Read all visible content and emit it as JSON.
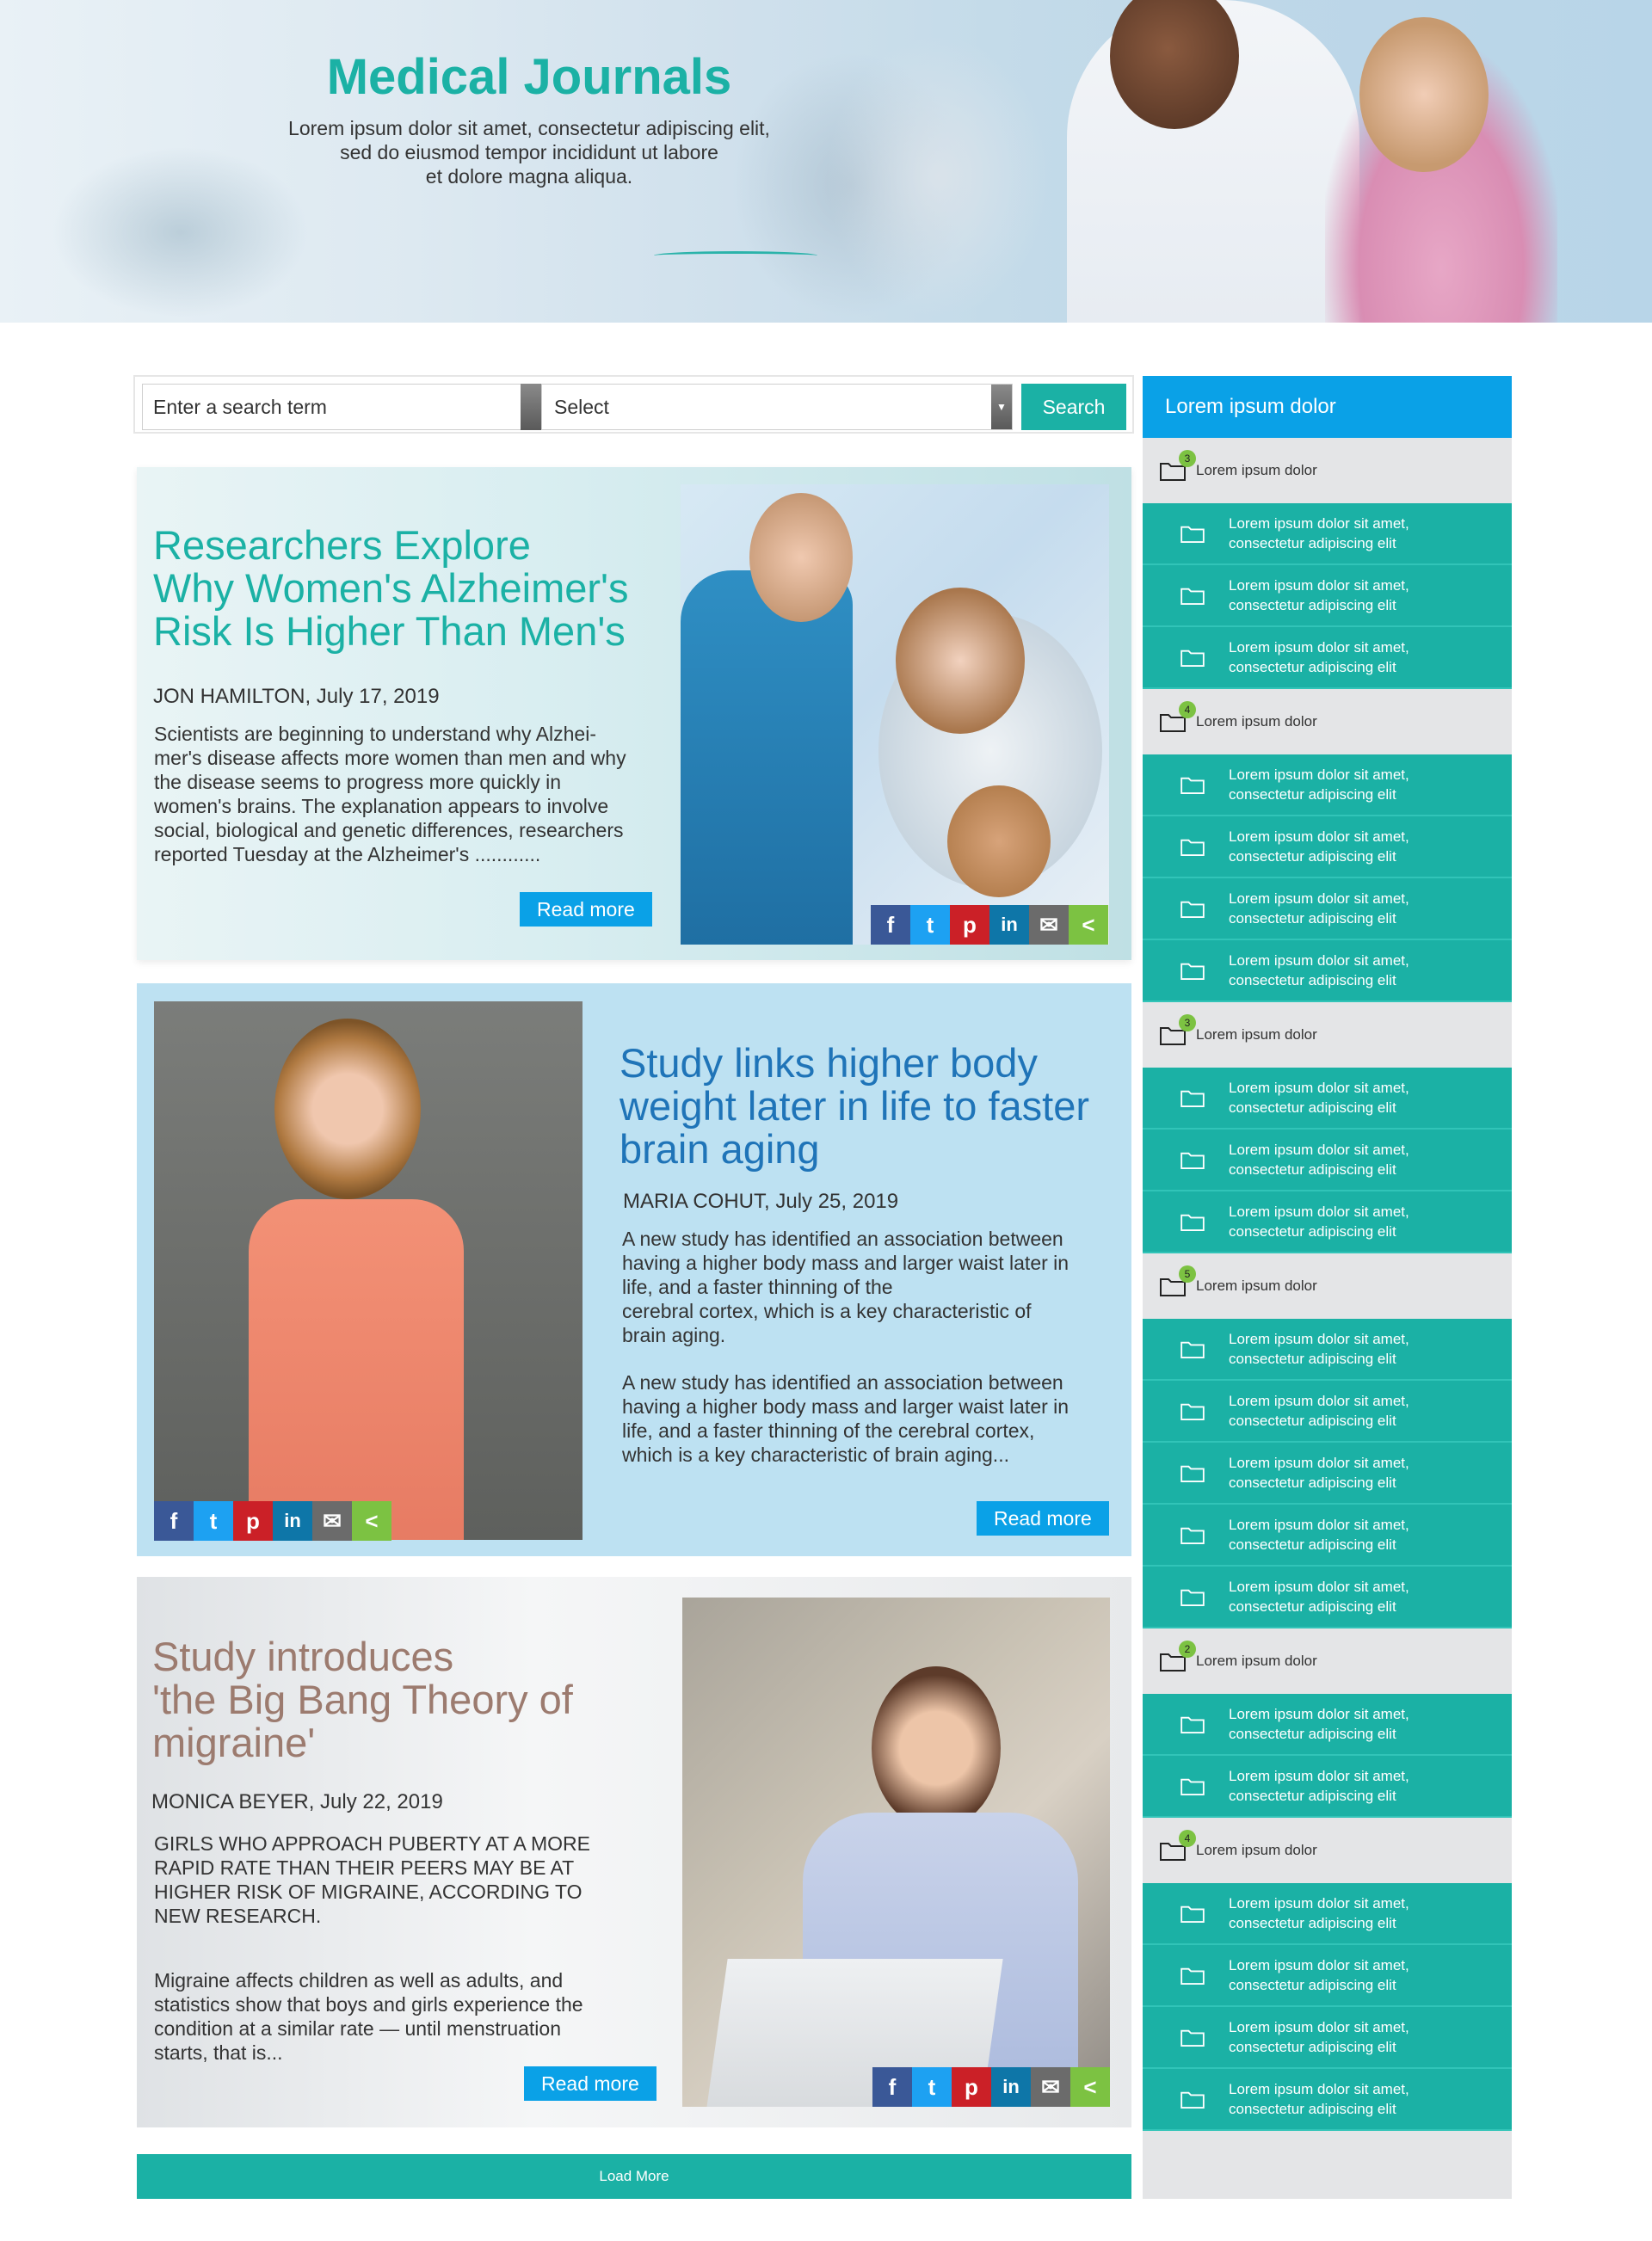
{
  "hero": {
    "title": "Medical Journals",
    "subtitle_lines": [
      "Lorem ipsum dolor sit amet, consectetur adipiscing elit,",
      "sed do eiusmod tempor incididunt ut labore",
      "et dolore magna aliqua."
    ]
  },
  "search": {
    "placeholder": "Enter a search term",
    "select_value": "Select",
    "button_label": "Search"
  },
  "articles": [
    {
      "title_lines": [
        "Researchers Explore",
        "Why Women's Alzheimer's",
        "Risk Is Higher Than Men's"
      ],
      "byline": "JON HAMILTON, July 17, 2019",
      "paragraph_lines": [
        "Scientists are beginning to understand why Alzhei-",
        "mer's disease affects more women than men and why",
        "the disease seems to progress more quickly in",
        "women's brains. The explanation appears to involve",
        "social, biological and genetic differences, researchers",
        "reported Tuesday at the Alzheimer's ............"
      ],
      "read_more": "Read more"
    },
    {
      "title_lines": [
        "Study links higher body",
        "weight later in life to faster",
        "brain aging"
      ],
      "byline": "MARIA COHUT, July 25, 2019",
      "paragraph1_lines": [
        "A new study has identified an association between",
        "having a higher body mass and larger waist later in",
        "life, and a faster thinning of the",
        "cerebral cortex, which is a key characteristic of",
        "brain aging."
      ],
      "paragraph2_lines": [
        "A new study has identified an association between",
        "having a higher body mass and larger waist later in",
        "life, and a faster thinning of the cerebral cortex,",
        "which is a key characteristic of brain aging..."
      ],
      "read_more": "Read more"
    },
    {
      "title_lines": [
        "Study introduces",
        "'the Big Bang Theory of",
        "migraine'"
      ],
      "byline": "MONICA BEYER, July 22, 2019",
      "paragraph1_lines": [
        "GIRLS WHO APPROACH PUBERTY AT A MORE",
        "RAPID RATE THAN THEIR PEERS MAY BE AT",
        "HIGHER RISK OF MIGRAINE, ACCORDING TO",
        "NEW RESEARCH."
      ],
      "paragraph2_lines": [
        "Migraine affects children as well as adults, and",
        "statistics show that boys and girls experience the",
        "condition at a similar rate — until menstruation",
        "starts, that is..."
      ],
      "read_more": "Read more"
    }
  ],
  "load_more": "Load More",
  "share_icons": [
    "facebook-icon",
    "twitter-icon",
    "pinterest-icon",
    "linkedin-icon",
    "email-icon",
    "share-icon"
  ],
  "sidebar": {
    "header": "Lorem ipsum dolor",
    "groups": [
      {
        "label": "Lorem ipsum dolor",
        "badge": "3",
        "items": [
          [
            "Lorem ipsum dolor sit amet,",
            "consectetur adipiscing elit"
          ],
          [
            "Lorem ipsum dolor sit amet,",
            "consectetur adipiscing elit"
          ],
          [
            "Lorem ipsum dolor sit amet,",
            "consectetur adipiscing elit"
          ]
        ]
      },
      {
        "label": "Lorem ipsum dolor",
        "badge": "4",
        "items": [
          [
            "Lorem ipsum dolor sit amet,",
            "consectetur adipiscing elit"
          ],
          [
            "Lorem ipsum dolor sit amet,",
            "consectetur adipiscing elit"
          ],
          [
            "Lorem ipsum dolor sit amet,",
            "consectetur adipiscing elit"
          ],
          [
            "Lorem ipsum dolor sit amet,",
            "consectetur adipiscing elit"
          ]
        ]
      },
      {
        "label": "Lorem ipsum dolor",
        "badge": "3",
        "items": [
          [
            "Lorem ipsum dolor sit amet,",
            "consectetur adipiscing elit"
          ],
          [
            "Lorem ipsum dolor sit amet,",
            "consectetur adipiscing elit"
          ],
          [
            "Lorem ipsum dolor sit amet,",
            "consectetur adipiscing elit"
          ]
        ]
      },
      {
        "label": "Lorem ipsum dolor",
        "badge": "5",
        "items": [
          [
            "Lorem ipsum dolor sit amet,",
            "consectetur adipiscing elit"
          ],
          [
            "Lorem ipsum dolor sit amet,",
            "consectetur adipiscing elit"
          ],
          [
            "Lorem ipsum dolor sit amet,",
            "consectetur adipiscing elit"
          ],
          [
            "Lorem ipsum dolor sit amet,",
            "consectetur adipiscing elit"
          ],
          [
            "Lorem ipsum dolor sit amet,",
            "consectetur adipiscing elit"
          ]
        ]
      },
      {
        "label": "Lorem ipsum dolor",
        "badge": "2",
        "items": [
          [
            "Lorem ipsum dolor sit amet,",
            "consectetur adipiscing elit"
          ],
          [
            "Lorem ipsum dolor sit amet,",
            "consectetur adipiscing elit"
          ]
        ]
      },
      {
        "label": "Lorem ipsum dolor",
        "badge": "4",
        "items": [
          [
            "Lorem ipsum dolor sit amet,",
            "consectetur adipiscing elit"
          ],
          [
            "Lorem ipsum dolor sit amet,",
            "consectetur adipiscing elit"
          ],
          [
            "Lorem ipsum dolor sit amet,",
            "consectetur adipiscing elit"
          ],
          [
            "Lorem ipsum dolor sit amet,",
            "consectetur adipiscing elit"
          ]
        ]
      }
    ]
  },
  "colors": {
    "teal": "#1bb1a5",
    "blue": "#0aa1e7",
    "title_blue": "#1f74b8",
    "title_brown": "#9c7b6f",
    "badge_green": "#7cc242"
  }
}
